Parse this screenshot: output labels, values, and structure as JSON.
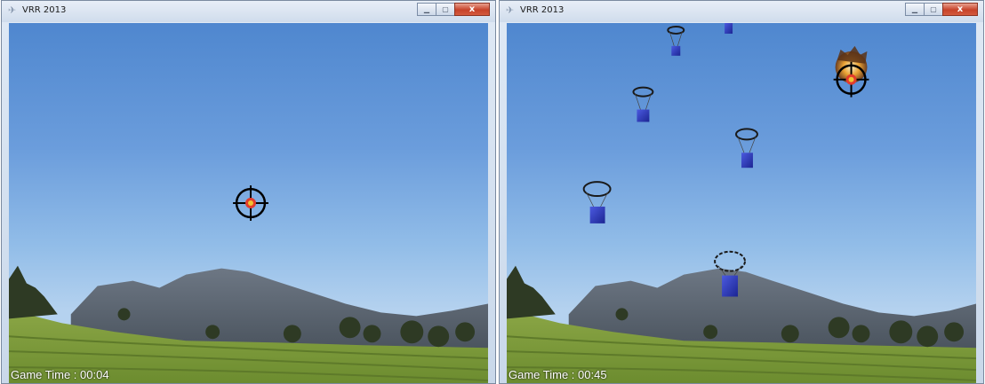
{
  "left_window": {
    "title": "VRR 2013",
    "hud": {
      "game_time": "Game Time : 00:04"
    }
  },
  "right_window": {
    "title": "VRR 2013",
    "hud": {
      "game_time": "Game Time : 00:45"
    }
  },
  "window_controls": {
    "minimize_icon": "minimize-icon",
    "maximize_icon": "maximize-icon",
    "close_label": "x"
  },
  "colors": {
    "sky_top": "#4f87cf",
    "sky_bottom": "#b5d2ef",
    "mountain": "#55606e",
    "field": "#7b9a3a",
    "crate": "#2a36b8",
    "crosshair": "#000000",
    "target_core": "#e23b2b",
    "explosion": "#f2a32b",
    "hud_text": "#ffffff"
  }
}
